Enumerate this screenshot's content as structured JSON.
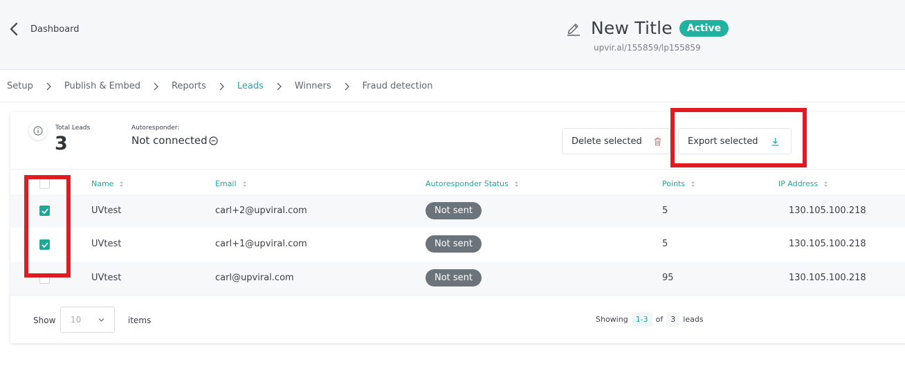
{
  "header": {
    "back_label": "Dashboard",
    "title": "New Title",
    "status_badge": "Active",
    "url": "upvir.al/155859/lp155859"
  },
  "tabs": [
    {
      "label": "Setup",
      "active": false
    },
    {
      "label": "Publish & Embed",
      "active": false
    },
    {
      "label": "Reports",
      "active": false
    },
    {
      "label": "Leads",
      "active": true
    },
    {
      "label": "Winners",
      "active": false
    },
    {
      "label": "Fraud detection",
      "active": false
    }
  ],
  "stats": {
    "total_leads_label": "Total Leads",
    "total_leads_value": "3",
    "autoresponder_label": "Autoresponder:",
    "autoresponder_value": "Not connected"
  },
  "actions": {
    "delete_label": "Delete selected",
    "export_label": "Export selected"
  },
  "table": {
    "columns": [
      "Name",
      "Email",
      "Autoresponder Status",
      "Points",
      "IP Address"
    ],
    "rows": [
      {
        "checked": true,
        "name": "UVtest",
        "email": "carl+2@upviral.com",
        "status": "Not sent",
        "points": "5",
        "ip": "130.105.100.218"
      },
      {
        "checked": true,
        "name": "UVtest",
        "email": "carl+1@upviral.com",
        "status": "Not sent",
        "points": "5",
        "ip": "130.105.100.218"
      },
      {
        "checked": false,
        "name": "UVtest",
        "email": "carl@upviral.com",
        "status": "Not sent",
        "points": "95",
        "ip": "130.105.100.218"
      }
    ]
  },
  "footer": {
    "show_label": "Show",
    "page_size": "10",
    "items_label": "items",
    "showing_label": "Showing",
    "range": "1-3",
    "of_label": "of",
    "total": "3",
    "leads_label": "leads"
  },
  "colors": {
    "accent": "#1fa89a",
    "active_badge": "#1fb2a0",
    "highlight": "#e21b23",
    "pill": "#6c737a"
  }
}
